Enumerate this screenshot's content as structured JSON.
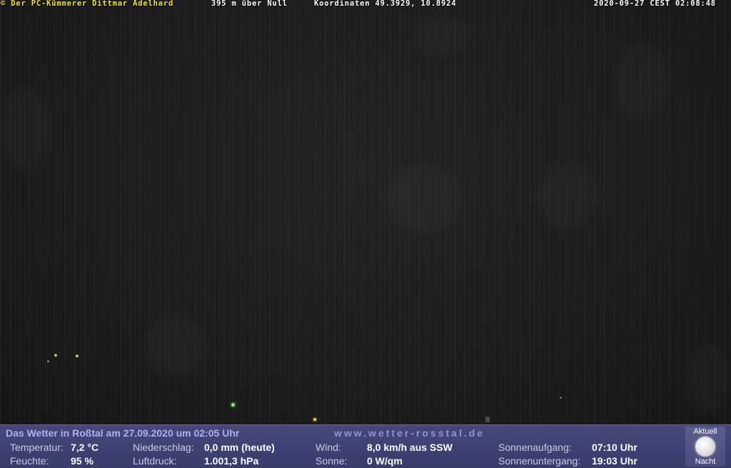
{
  "overlay": {
    "copyright": "© Der PC-Kümmerer Dittmar Adelhard",
    "altitude": "395 m über Null",
    "coordinates": "Koordinaten 49.3929, 10.8924",
    "timestamp": "2020-09-27 CEST 02:08:48"
  },
  "weather": {
    "title": "Das Wetter in Roßtal am 27.09.2020 um 02:05 Uhr",
    "website": "www.wetter-rosstal.de",
    "temperature_label": "Temperatur:",
    "temperature_value": "7,2 °C",
    "humidity_label": "Feuchte:",
    "humidity_value": "95 %",
    "precipitation_label": "Niederschlag:",
    "precipitation_value": "0,0 mm (heute)",
    "pressure_label": "Luftdruck:",
    "pressure_value": "1.001,3 hPa",
    "wind_label": "Wind:",
    "wind_value": "8,0 km/h aus SSW",
    "sun_label": "Sonne:",
    "sun_value": "0 W/qm",
    "sunrise_label": "Sonnenaufgang:",
    "sunrise_value": "07:10 Uhr",
    "sunset_label": "Sonnenuntergang:",
    "sunset_value": "19:03 Uhr"
  },
  "moon": {
    "top_label": "Aktuell",
    "bottom_label": "Nacht",
    "icon": "full-moon-icon"
  },
  "colors": {
    "overlay_text": "#f1e23a",
    "panel_bg": "#41437a",
    "title_text": "#aab0f0"
  }
}
